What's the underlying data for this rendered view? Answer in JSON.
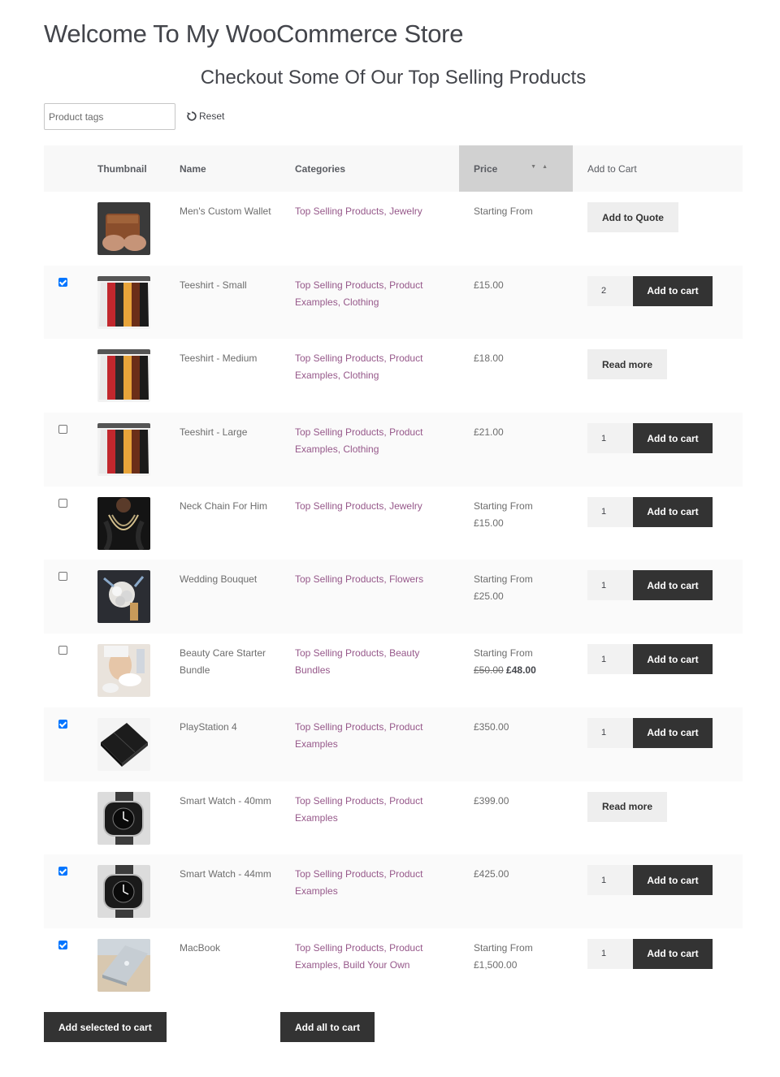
{
  "page": {
    "title": "Welcome To My WooCommerce Store",
    "subtitle": "Checkout Some Of Our Top Selling Products"
  },
  "filter": {
    "placeholder": "Product tags",
    "reset_label": "Reset"
  },
  "table": {
    "headers": {
      "thumbnail": "Thumbnail",
      "name": "Name",
      "categories": "Categories",
      "price": "Price",
      "add_to_cart": "Add to Cart"
    },
    "rows": [
      {
        "name": "Men's Custom Wallet",
        "categories": "Top Selling Products, Jewelry",
        "price_line1": "Starting From",
        "price_line2": "",
        "checkbox": "none",
        "action": "Add to Quote",
        "action_type": "light",
        "qty": ""
      },
      {
        "name": "Teeshirt - Small",
        "categories": "Top Selling Products, Product Examples, Clothing",
        "price_line1": "£15.00",
        "price_line2": "",
        "checkbox": "checked",
        "action": "Add to cart",
        "action_type": "dark",
        "qty": "2"
      },
      {
        "name": "Teeshirt - Medium",
        "categories": "Top Selling Products, Product Examples, Clothing",
        "price_line1": "£18.00",
        "price_line2": "",
        "checkbox": "none",
        "action": "Read more",
        "action_type": "light",
        "qty": ""
      },
      {
        "name": "Teeshirt - Large",
        "categories": "Top Selling Products, Product Examples, Clothing",
        "price_line1": "£21.00",
        "price_line2": "",
        "checkbox": "unchecked",
        "action": "Add to cart",
        "action_type": "dark",
        "qty": "1"
      },
      {
        "name": "Neck Chain For Him",
        "categories": "Top Selling Products, Jewelry",
        "price_line1": "Starting From",
        "price_line2": "£15.00",
        "checkbox": "unchecked",
        "action": "Add to cart",
        "action_type": "dark",
        "qty": "1"
      },
      {
        "name": "Wedding Bouquet",
        "categories": "Top Selling Products, Flowers",
        "price_line1": "Starting From",
        "price_line2": "£25.00",
        "checkbox": "unchecked",
        "action": "Add to cart",
        "action_type": "dark",
        "qty": "1"
      },
      {
        "name": "Beauty Care Starter Bundle",
        "categories": "Top Selling Products, Beauty Bundles",
        "price_line1": "Starting From",
        "price_old": "£50.00",
        "price_new": "£48.00",
        "checkbox": "unchecked",
        "action": "Add to cart",
        "action_type": "dark",
        "qty": "1"
      },
      {
        "name": "PlayStation 4",
        "categories": "Top Selling Products, Product Examples",
        "price_line1": "£350.00",
        "price_line2": "",
        "checkbox": "checked",
        "action": "Add to cart",
        "action_type": "dark",
        "qty": "1"
      },
      {
        "name": "Smart Watch - 40mm",
        "categories": "Top Selling Products, Product Examples",
        "price_line1": "£399.00",
        "price_line2": "",
        "checkbox": "none",
        "action": "Read more",
        "action_type": "light",
        "qty": ""
      },
      {
        "name": "Smart Watch - 44mm",
        "categories": "Top Selling Products, Product Examples",
        "price_line1": "£425.00",
        "price_line2": "",
        "checkbox": "checked",
        "action": "Add to cart",
        "action_type": "dark",
        "qty": "1"
      },
      {
        "name": "MacBook",
        "categories": "Top Selling Products, Product Examples, Build Your Own",
        "price_line1": "Starting From",
        "price_line2": "£1,500.00",
        "checkbox": "checked",
        "action": "Add to cart",
        "action_type": "dark",
        "qty": "1"
      }
    ]
  },
  "bottom": {
    "add_selected": "Add selected to cart",
    "add_all": "Add all to cart"
  },
  "colors": {
    "category_link": "#96588a",
    "dark_button": "#333333",
    "checkbox_on": "#0075ff"
  },
  "icons": [
    "reset-icon",
    "sort-arrows-icon"
  ]
}
